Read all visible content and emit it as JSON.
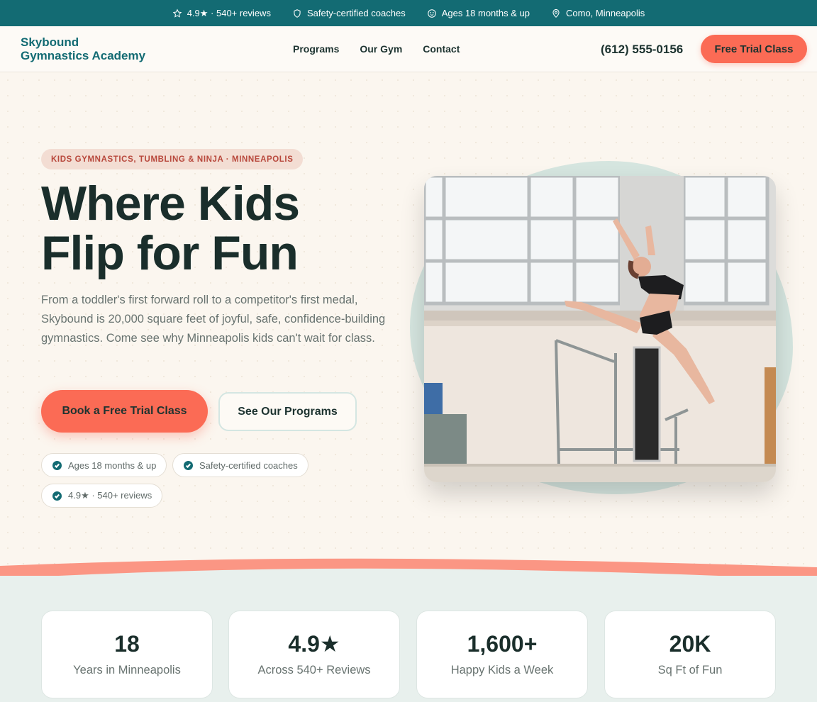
{
  "topbar": {
    "items": [
      {
        "icon": "star-icon",
        "text": "4.9★ · 540+ reviews"
      },
      {
        "icon": "shield-icon",
        "text": "Safety-certified coaches"
      },
      {
        "icon": "smile-icon",
        "text": "Ages 18 months & up"
      },
      {
        "icon": "location-pin-icon",
        "text": "Como, Minneapolis"
      }
    ],
    "background": "#136b73"
  },
  "nav": {
    "logo_line1": "Skybound",
    "logo_line2": "Gymnastics Academy",
    "links": [
      "Programs",
      "Our Gym",
      "Contact"
    ],
    "phone": "(612) 555-0156",
    "cta": "Free Trial Class"
  },
  "hero": {
    "eyebrow": "KIDS GYMNASTICS, TUMBLING & NINJA · MINNEAPOLIS",
    "headline_line1": "Where Kids",
    "headline_line2": "Flip for Fun",
    "subtext": "From a toddler's first forward roll to a competitor's first medal, Skybound is 20,000 square feet of joyful, safe, confidence-building gymnastics. Come see why Minneapolis kids can't wait for class.",
    "primary_button": "Book a Free Trial Class",
    "secondary_button": "See Our Programs",
    "badges": [
      "Ages 18 months & up",
      "Safety-certified coaches",
      "4.9★ · 540+ reviews"
    ]
  },
  "stats": [
    {
      "value": "18",
      "label": "Years in Minneapolis"
    },
    {
      "value": "4.9★",
      "label": "Across 540+ Reviews"
    },
    {
      "value": "1,600+",
      "label": "Happy Kids a Week"
    },
    {
      "value": "20K",
      "label": "Sq Ft of Fun"
    }
  ],
  "colors": {
    "accent": "#fb6b55",
    "brand": "#136b73",
    "dark_text": "#1a2e2b",
    "hero_bg": "#fbf6ef",
    "stats_bg": "#e8f0ed"
  }
}
